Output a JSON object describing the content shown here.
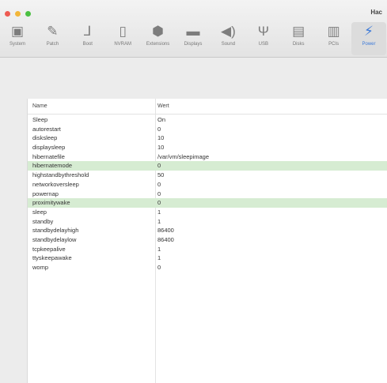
{
  "window": {
    "title": "Hac"
  },
  "toolbar": {
    "items": [
      {
        "label": "System",
        "icon": "system-icon",
        "glyph": "▣"
      },
      {
        "label": "Patch",
        "icon": "patch-icon",
        "glyph": "✎"
      },
      {
        "label": "Boot",
        "icon": "boot-icon",
        "glyph": "⅃"
      },
      {
        "label": "NVRAM",
        "icon": "nvram-icon",
        "glyph": "▯"
      },
      {
        "label": "Extensions",
        "icon": "extensions-icon",
        "glyph": "⬢"
      },
      {
        "label": "Displays",
        "icon": "displays-icon",
        "glyph": "▬"
      },
      {
        "label": "Sound",
        "icon": "sound-icon",
        "glyph": "◀)"
      },
      {
        "label": "USB",
        "icon": "usb-icon",
        "glyph": "Ψ"
      },
      {
        "label": "Disks",
        "icon": "disks-icon",
        "glyph": "▤"
      },
      {
        "label": "PCIs",
        "icon": "pcis-icon",
        "glyph": "▥"
      },
      {
        "label": "Power",
        "icon": "power-icon",
        "glyph": "⚡",
        "active": true
      }
    ]
  },
  "table": {
    "columns": [
      "Name",
      "Wert"
    ],
    "rows": [
      {
        "name": "Sleep",
        "value": "On"
      },
      {
        "name": "autorestart",
        "value": "0"
      },
      {
        "name": "disksleep",
        "value": "10"
      },
      {
        "name": "displaysleep",
        "value": "10"
      },
      {
        "name": "hibernatefile",
        "value": "/var/vm/sleepimage"
      },
      {
        "name": "hibernatemode",
        "value": "0",
        "selected": true
      },
      {
        "name": "highstandbythreshold",
        "value": "50"
      },
      {
        "name": "networkoversleep",
        "value": "0"
      },
      {
        "name": "powernap",
        "value": "0"
      },
      {
        "name": "proximitywake",
        "value": "0",
        "selected": true
      },
      {
        "name": "sleep",
        "value": "1"
      },
      {
        "name": "standby",
        "value": "1"
      },
      {
        "name": "standbydelayhigh",
        "value": "86400"
      },
      {
        "name": "standbydelaylow",
        "value": "86400"
      },
      {
        "name": "tcpkeepalive",
        "value": "1"
      },
      {
        "name": "ttyskeepawake",
        "value": "1"
      },
      {
        "name": "womp",
        "value": "0"
      }
    ]
  },
  "colors": {
    "selection": "#d6ecd2",
    "accent": "#3d7ad8"
  }
}
